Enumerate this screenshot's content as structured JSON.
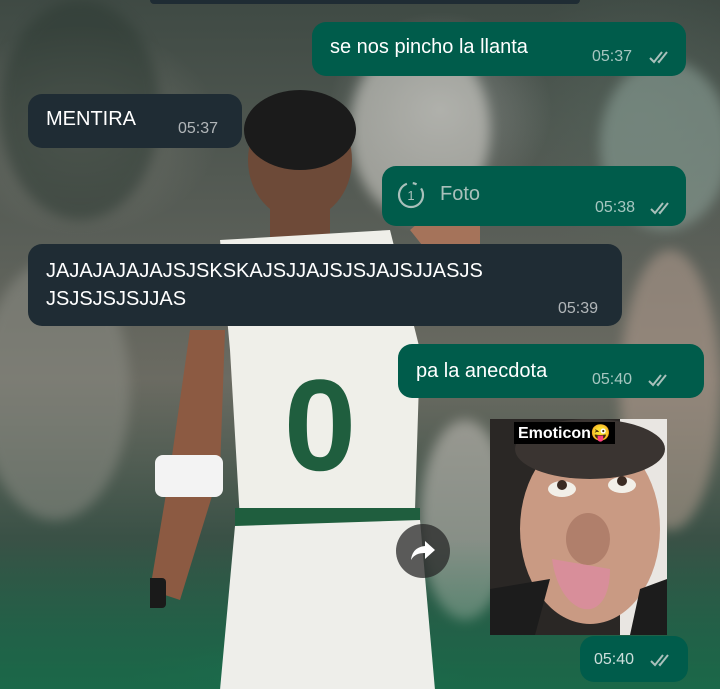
{
  "chat": {
    "messages": [
      {
        "direction": "outgoing",
        "text": "se nos pincho la llanta",
        "time": "05:37",
        "status": "read-ticks-icon"
      },
      {
        "direction": "incoming",
        "text": "MENTIRA",
        "time": "05:37"
      },
      {
        "direction": "outgoing",
        "type": "view-once-photo",
        "icon": "view-once-icon",
        "badge": "1",
        "text": "Foto",
        "time": "05:38",
        "status": "read-ticks-icon"
      },
      {
        "direction": "incoming",
        "text_line1": "JAJAJAJAJAJSJSKSKAJSJJAJSJSJAJSJJASJS",
        "text_line2": "JSJSJSJSJJAS",
        "time": "05:39"
      },
      {
        "direction": "outgoing",
        "text": "pa la anecdota",
        "time": "05:40",
        "status": "read-ticks-icon"
      },
      {
        "direction": "outgoing",
        "type": "sticker",
        "caption": "Emoticon😜",
        "forward_icon": "forward-arrow-icon",
        "time": "05:40",
        "status": "read-ticks-icon"
      }
    ]
  },
  "colors": {
    "outgoing": "#005c4b",
    "incoming": "#1f2c34",
    "ticks": "#a9c0bb"
  }
}
